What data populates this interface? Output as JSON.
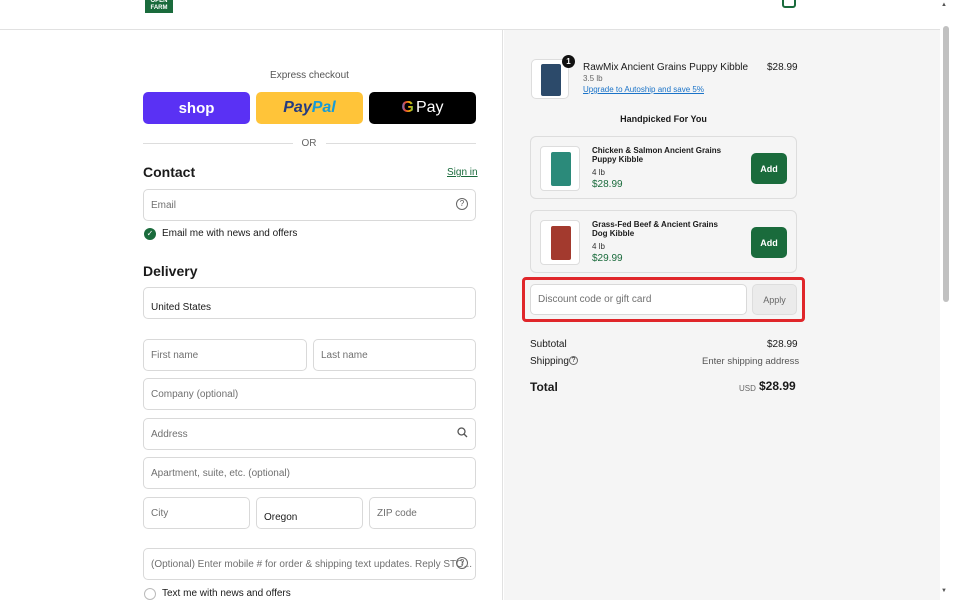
{
  "brand": {
    "logo_text": "OPEN FARM"
  },
  "express": {
    "title": "Express checkout",
    "shop_label": "shop",
    "paypal_part1": "Pay",
    "paypal_part2": "Pal",
    "gpay_g": "G",
    "gpay_label": "Pay",
    "or_label": "OR"
  },
  "contact": {
    "title": "Contact",
    "sign_in": "Sign in",
    "email_placeholder": "Email",
    "news_label": "Email me with news and offers"
  },
  "delivery": {
    "title": "Delivery",
    "country": "United States",
    "first_name": "First name",
    "last_name": "Last name",
    "company": "Company (optional)",
    "address": "Address",
    "apartment": "Apartment, suite, etc. (optional)",
    "city": "City",
    "state": "Oregon",
    "zip": "ZIP code",
    "phone": "(Optional) Enter mobile # for order & shipping text updates. Reply STO...",
    "text_label": "Text me with news and offers"
  },
  "cart": {
    "item": {
      "name": "RawMix Ancient Grains Puppy Kibble",
      "weight": "3.5 lb",
      "price": "$28.99",
      "qty": "1",
      "autoship": "Upgrade to Autoship and save 5%"
    },
    "handpicked_title": "Handpicked For You",
    "recommendations": [
      {
        "name": "Chicken & Salmon Ancient Grains Puppy Kibble",
        "weight": "4 lb",
        "price": "$28.99",
        "add": "Add",
        "color": "#2b8a7a"
      },
      {
        "name": "Grass-Fed Beef & Ancient Grains Dog Kibble",
        "weight": "4 lb",
        "price": "$29.99",
        "add": "Add",
        "color": "#a33a2e"
      }
    ],
    "discount_placeholder": "Discount code or gift card",
    "apply": "Apply",
    "subtotal_label": "Subtotal",
    "subtotal_value": "$28.99",
    "shipping_label": "Shipping",
    "shipping_value": "Enter shipping address",
    "total_label": "Total",
    "total_currency": "USD",
    "total_value": "$28.99"
  },
  "colors": {
    "accent": "#1a6b3c",
    "highlight": "#e0262a",
    "shop": "#5a31f4",
    "paypal": "#ffc439"
  }
}
